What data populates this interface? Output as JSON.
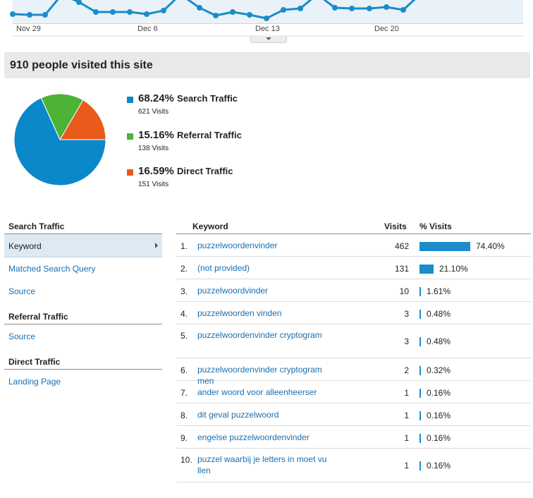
{
  "colors": {
    "line": "#1a8ccb",
    "area": "#e8f2f8",
    "search": "#0b88c9",
    "referral": "#4cb336",
    "direct": "#ea5a1d",
    "bar": "#1a8ccb",
    "link": "#1a6fb0"
  },
  "trend_chart": {
    "date_labels": [
      "Nov 29",
      "Dec 6",
      "Dec 13",
      "Dec 20"
    ]
  },
  "summary": {
    "title": "910 people visited this site"
  },
  "chart_data": {
    "type": "pie",
    "slices": [
      {
        "name": "Search Traffic",
        "percent": "68.24%",
        "value": 68.24,
        "visits": "621 Visits"
      },
      {
        "name": "Referral Traffic",
        "percent": "15.16%",
        "value": 15.16,
        "visits": "138 Visits"
      },
      {
        "name": "Direct Traffic",
        "percent": "16.59%",
        "value": 16.59,
        "visits": "151 Visits"
      }
    ]
  },
  "nav": {
    "search_heading": "Search Traffic",
    "search_items": [
      "Keyword",
      "Matched Search Query",
      "Source"
    ],
    "referral_heading": "Referral Traffic",
    "referral_items": [
      "Source"
    ],
    "direct_heading": "Direct Traffic",
    "direct_items": [
      "Landing Page"
    ]
  },
  "table": {
    "headers": {
      "keyword": "Keyword",
      "visits": "Visits",
      "pct": "% Visits"
    },
    "rows": [
      {
        "num": "1.",
        "keyword": "puzzelwoordenvinder",
        "visits": "462",
        "pct": "74.40%",
        "pct_value": 74.4
      },
      {
        "num": "2.",
        "keyword": "(not provided)",
        "visits": "131",
        "pct": "21.10%",
        "pct_value": 21.1
      },
      {
        "num": "3.",
        "keyword": "puzzelwoordvinder",
        "visits": "10",
        "pct": "1.61%",
        "pct_value": 1.61
      },
      {
        "num": "4.",
        "keyword": "puzzelwoorden vinden",
        "visits": "3",
        "pct": "0.48%",
        "pct_value": 0.48
      },
      {
        "num": "5.",
        "keyword": "puzzelwoordenvinder cryptogram",
        "visits": "3",
        "pct": "0.48%",
        "pct_value": 0.48
      },
      {
        "num": "6.",
        "keyword": "puzzelwoordenvinder cryptogrammen",
        "visits": "2",
        "pct": "0.32%",
        "pct_value": 0.32
      },
      {
        "num": "7.",
        "keyword": "ander woord voor alleenheerser",
        "visits": "1",
        "pct": "0.16%",
        "pct_value": 0.16
      },
      {
        "num": "8.",
        "keyword": "dit geval puzzelwoord",
        "visits": "1",
        "pct": "0.16%",
        "pct_value": 0.16
      },
      {
        "num": "9.",
        "keyword": "engelse puzzelwoordenvinder",
        "visits": "1",
        "pct": "0.16%",
        "pct_value": 0.16
      },
      {
        "num": "10.",
        "keyword": "puzzel waarbij je letters in moet vullen",
        "visits": "1",
        "pct": "0.16%",
        "pct_value": 0.16
      }
    ]
  }
}
